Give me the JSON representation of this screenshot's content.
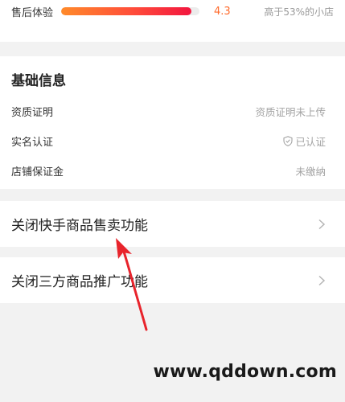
{
  "rating": {
    "label": "售后体验",
    "score": "4.3",
    "compare": "高于53%的小店",
    "fill_fraction": 0.94
  },
  "basic_info": {
    "title": "基础信息",
    "rows": [
      {
        "key": "资质证明",
        "value": "资质证明未上传"
      },
      {
        "key": "实名认证",
        "value": "已认证"
      },
      {
        "key": "店铺保证金",
        "value": "未缴纳"
      }
    ]
  },
  "actions": [
    {
      "label": "关闭快手商品售卖功能"
    },
    {
      "label": "关闭三方商品推广功能"
    }
  ],
  "watermark": "www.qddown.com",
  "colors": {
    "accent_orange": "#ff6a2b",
    "bar_gradient_end": "#f2163f",
    "annotation_red": "#e8242c"
  }
}
